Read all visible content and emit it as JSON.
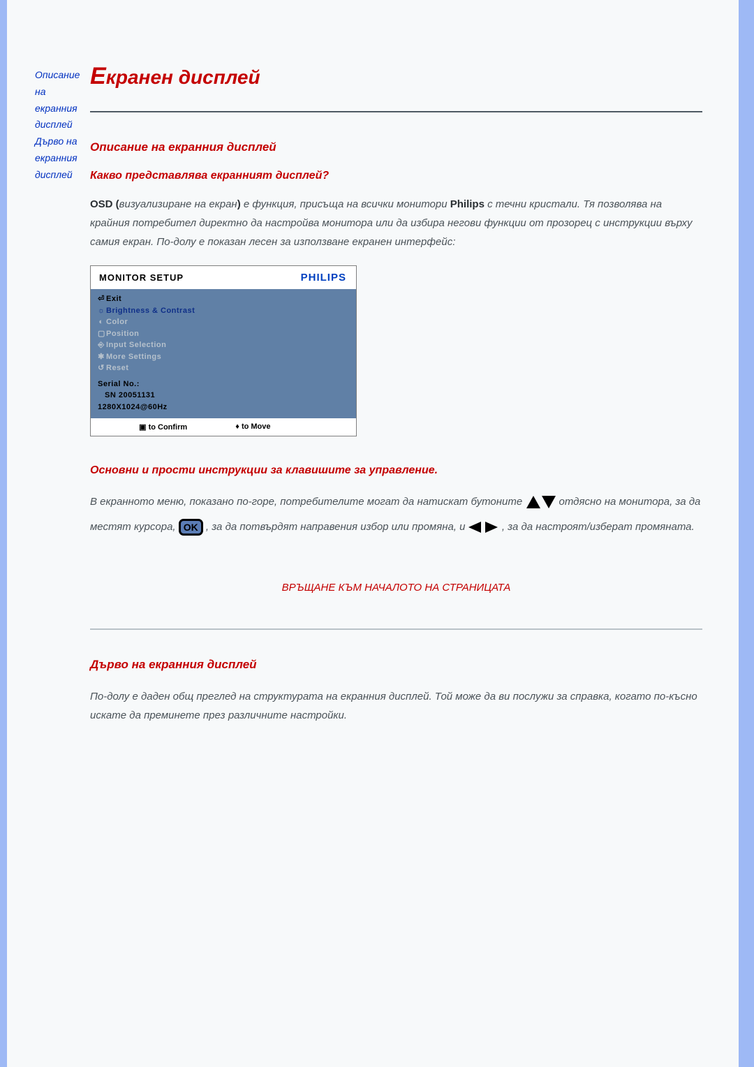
{
  "sidebar": {
    "link1": "Описание на екранния дисплей",
    "link2": "Дърво на екранния дисплей"
  },
  "page_title_first": "Е",
  "page_title_rest": "кранен дисплей",
  "section1": {
    "heading": "Описание на екранния дисплей",
    "sub": "Какво представлява екранният дисплей?",
    "para_osd_bold": "OSD (",
    "para_part1": "визуализиране на екран",
    "para_paren_close": ") ",
    "para_part2": "е функция, присъща на всички монитори ",
    "para_brand": "Philips",
    "para_part3": " с течни кристали. Тя позволява на крайния потребител директно да настройва монитора или да избира негови функции от прозорец с инструкции върху самия екран. По-долу е показан лесен за използване екранен интерфейс:"
  },
  "osd": {
    "header_title": "MONITOR SETUP",
    "brand": "PHILIPS",
    "items": {
      "exit": "Exit",
      "bc": "Brightness & Contrast",
      "color": "Color",
      "position": "Position",
      "input": "Input Selection",
      "more": "More Settings",
      "reset": "Reset"
    },
    "serial_label": "Serial No.:",
    "serial_num": "SN 20051131",
    "resolution": "1280X1024@60Hz",
    "footer_confirm_icon": "▣",
    "footer_confirm": "to Confirm",
    "footer_move_icon": "♦",
    "footer_move": "to Move"
  },
  "instr": {
    "heading": "Основни и прости инструкции за клавишите за управление.",
    "p1": "В екранното меню, показано по-горе, потребителите могат да натискат бутоните ",
    "p2": " отдясно на монитора, за да местят курсора, ",
    "p3": " , за да потвърдят направения избор или промяна, и ",
    "p4": " , за да настроят/изберат промяната.",
    "ok": "OK"
  },
  "toplink": "ВРЪЩАНЕ КЪМ НАЧАЛОТО НА СТРАНИЦАТА",
  "section2": {
    "heading": "Дърво на екранния дисплей",
    "para": "По-долу е даден общ преглед на структурата на екранния дисплей. Той може да ви послужи за справка, когато по-късно искате да преминете през различните настройки."
  }
}
